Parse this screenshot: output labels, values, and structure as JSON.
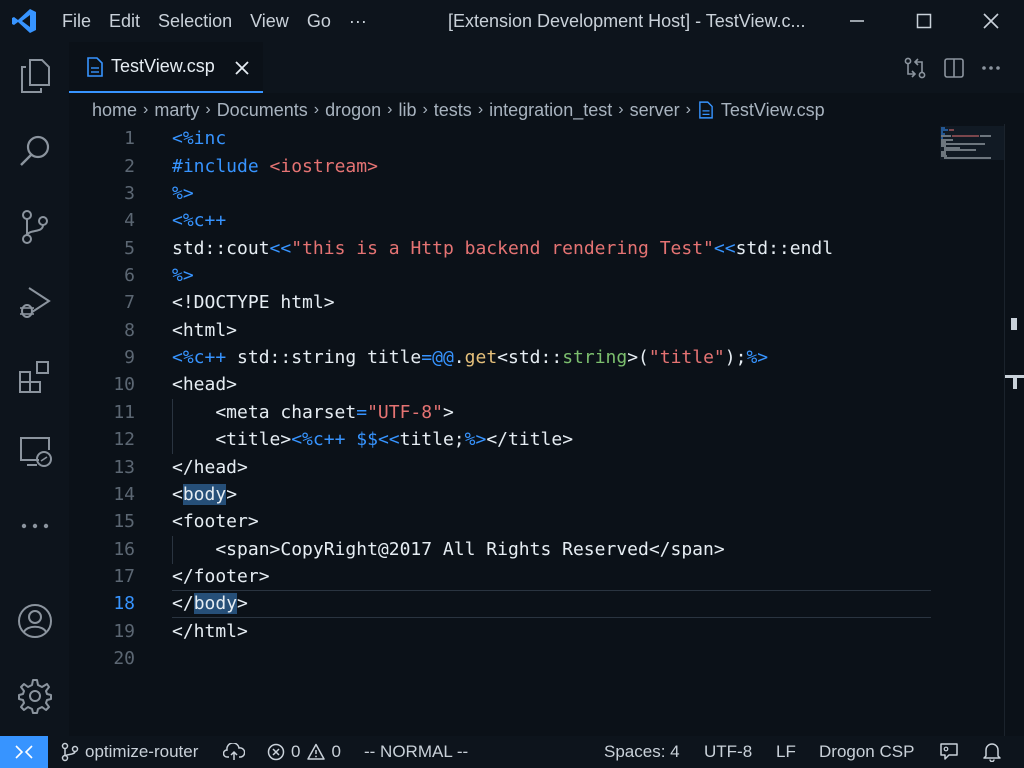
{
  "titlebar": {
    "menu": [
      "File",
      "Edit",
      "Selection",
      "View",
      "Go",
      "···"
    ],
    "window_title": "[Extension Development Host] - TestView.c..."
  },
  "activitybar": {
    "icons": [
      "explorer-icon",
      "search-icon",
      "source-control-icon",
      "run-debug-icon",
      "extensions-icon",
      "remote-explorer-icon",
      "more-icon",
      "account-icon",
      "settings-gear-icon"
    ]
  },
  "tabs": [
    {
      "label": "TestView.csp",
      "active": true,
      "icon": "file-icon"
    }
  ],
  "breadcrumb": [
    "home",
    "marty",
    "Documents",
    "drogon",
    "lib",
    "tests",
    "integration_test",
    "server",
    "TestView.csp"
  ],
  "editor": {
    "language": "csp",
    "active_line": 18,
    "line_numbers": [
      "1",
      "2",
      "3",
      "4",
      "5",
      "6",
      "7",
      "8",
      "9",
      "10",
      "11",
      "12",
      "13",
      "14",
      "15",
      "16",
      "17",
      "18",
      "19",
      "20"
    ],
    "lines": [
      "<%inc",
      "#include <iostream>",
      "%>",
      "<%c++",
      "std::cout<<\"this is a Http backend rendering Test\"<<std::endl",
      "%>",
      "<!DOCTYPE html>",
      "<html>",
      "<%c++ std::string title=@@.get<std::string>(\"title\");%>",
      "<head>",
      "    <meta charset=\"UTF-8\">",
      "    <title><%c++ $$<<title;%></title>",
      "</head>",
      "<body>",
      "<footer>",
      "    <span>CopyRight@2017 All Rights Reserved</span>",
      "</footer>",
      "</body>",
      "</html>",
      ""
    ]
  },
  "statusbar": {
    "branch": "optimize-router",
    "errors": "0",
    "warnings": "0",
    "mode": "-- NORMAL --",
    "spaces": "Spaces: 4",
    "encoding": "UTF-8",
    "eol": "LF",
    "language": "Drogon CSP"
  },
  "colors": {
    "accent": "#3794ff",
    "background": "#0b1118",
    "chrome": "#0d141c",
    "string": "#e57373",
    "type": "#7cbf6e",
    "function": "#e5c07b"
  }
}
